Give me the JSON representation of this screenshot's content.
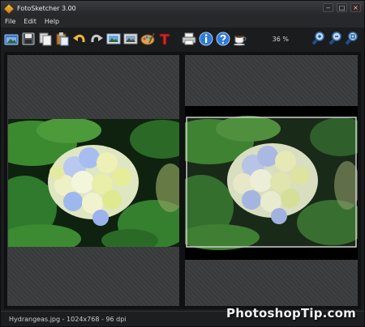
{
  "window": {
    "title": "FotoSketcher 3.00"
  },
  "menu": {
    "items": [
      "File",
      "Edit",
      "Help"
    ]
  },
  "toolbar": {
    "buttons": [
      "open-image-icon",
      "save-icon",
      "copy-icon",
      "paste-icon",
      "undo-icon",
      "redo-icon",
      "original-view-icon",
      "result-view-icon",
      "paint-palette-icon",
      "text-icon",
      "print-icon",
      "info-icon",
      "help-icon",
      "coffee-donate-icon"
    ],
    "zoom_level": "36 %",
    "zoom_buttons": [
      "zoom-in-icon",
      "zoom-out-icon",
      "zoom-fit-icon"
    ]
  },
  "status": {
    "text": "Hydrangeas.jpg - 1024x768 - 96 dpi"
  },
  "watermark": {
    "text": "PhotoshopTip.com"
  },
  "colors": {
    "accent_blue": "#2f7ad6",
    "flower_blue": "#9fb7ef",
    "flower_cream": "#eef0b5",
    "leaf_green": "#2f7a2c"
  }
}
